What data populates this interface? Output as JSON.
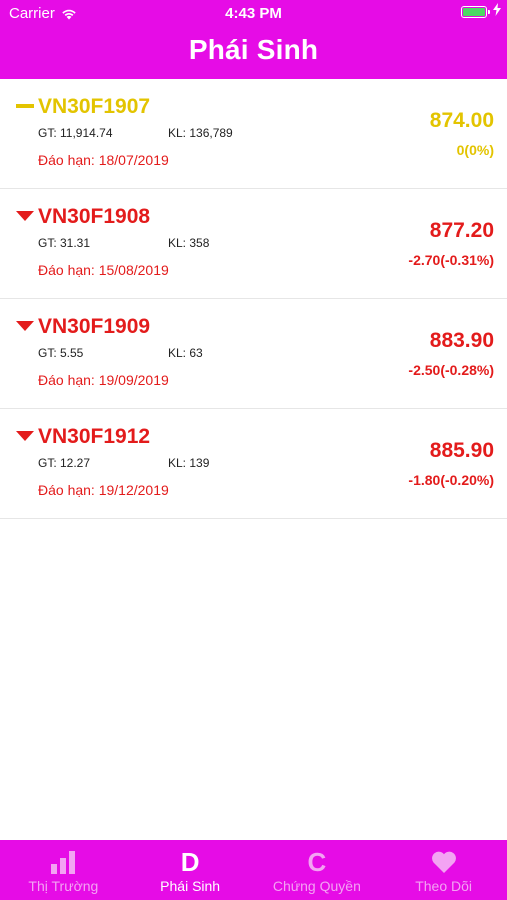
{
  "status": {
    "carrier": "Carrier",
    "time": "4:43 PM"
  },
  "header": {
    "title": "Phái Sinh"
  },
  "rows": [
    {
      "symbol": "VN30F1907",
      "trend": "flat",
      "gt": "GT: 11,914.74",
      "kl": "KL: 136,789",
      "expiry": "Đáo hạn: 18/07/2019",
      "price": "874.00",
      "change": "0(0%)",
      "color": "#e3c400"
    },
    {
      "symbol": "VN30F1908",
      "trend": "down",
      "gt": "GT: 31.31",
      "kl": "KL: 358",
      "expiry": "Đáo hạn: 15/08/2019",
      "price": "877.20",
      "change": "-2.70(-0.31%)",
      "color": "#e31b1b"
    },
    {
      "symbol": "VN30F1909",
      "trend": "down",
      "gt": "GT: 5.55",
      "kl": "KL: 63",
      "expiry": "Đáo hạn: 19/09/2019",
      "price": "883.90",
      "change": "-2.50(-0.28%)",
      "color": "#e31b1b"
    },
    {
      "symbol": "VN30F1912",
      "trend": "down",
      "gt": "GT: 12.27",
      "kl": "KL: 139",
      "expiry": "Đáo hạn: 19/12/2019",
      "price": "885.90",
      "change": "-1.80(-0.20%)",
      "color": "#e31b1b"
    }
  ],
  "tabs": [
    {
      "label": "Thị Trường",
      "icon": "bar-chart-icon",
      "active": false
    },
    {
      "label": "Phái Sinh",
      "icon": "letter-d-icon",
      "glyph": "D",
      "active": true
    },
    {
      "label": "Chứng Quyền",
      "icon": "letter-c-icon",
      "glyph": "C",
      "active": false
    },
    {
      "label": "Theo Dõi",
      "icon": "heart-icon",
      "active": false
    }
  ],
  "colors": {
    "brand": "#e60ce6",
    "up_flat": "#e3c400",
    "down": "#e31b1b",
    "tab_inactive": "#f3a3f3",
    "tab_active": "#ffffff"
  }
}
